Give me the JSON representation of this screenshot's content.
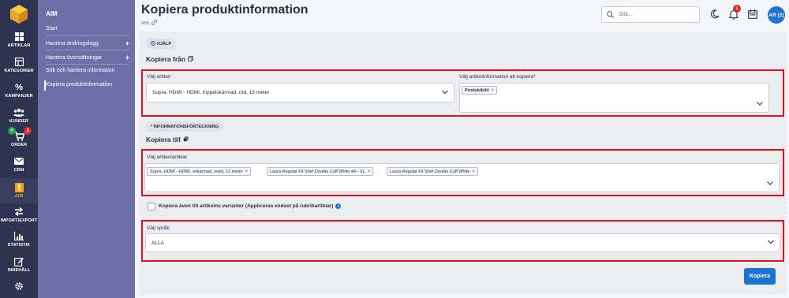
{
  "rail": {
    "items": [
      {
        "label": "ARTIKLAR",
        "icon": "grid-icon"
      },
      {
        "label": "KATEGORIER",
        "icon": "category-icon"
      },
      {
        "label": "KAMPANJER",
        "icon": "percent-icon"
      },
      {
        "label": "KUNDER",
        "icon": "users-icon"
      },
      {
        "label": "ORDER",
        "icon": "cart-icon"
      },
      {
        "label": "CRM",
        "icon": "mail-icon"
      },
      {
        "label": "AIM",
        "icon": "info-icon"
      },
      {
        "label": "IMPORT/EXPORT",
        "icon": "swap-icon"
      },
      {
        "label": "STATISTIK",
        "icon": "chart-icon"
      },
      {
        "label": "INNEHÅLL",
        "icon": "edit-icon"
      }
    ],
    "order_badges": {
      "left": "0",
      "right": "3"
    },
    "colors": {
      "green_badge": "#1fa34a",
      "red_badge": "#d92b2b"
    }
  },
  "subnav": {
    "title": "AIM",
    "items": [
      {
        "label": "Start"
      },
      {
        "label": "Hantera ändringslogg",
        "expandable": "+"
      },
      {
        "label": "Hantera översättningar",
        "expandable": "+"
      },
      {
        "label": "Sök och hantera information"
      },
      {
        "label": "Kopiera produktinformation"
      }
    ]
  },
  "header": {
    "title": "Kopiera produktinformation",
    "breadcrumb": "AIM",
    "search_placeholder": "Sök...",
    "notification_count": "1",
    "avatar": "AR (2)"
  },
  "help_pill": "HJÄLP",
  "copy_from": {
    "title": "Kopiera från",
    "article_label": "Välj artikel",
    "article_value": "Supra, HDMI - HDMI, trippelskärmad, röd, 15 meter",
    "info_label": "Välj artikelinformation att kopiera*",
    "info_tags": [
      "Produktbild"
    ]
  },
  "info_list_pill": "* INFORMATIONSFÖRTECKNING",
  "copy_to": {
    "title": "Kopiera till",
    "articles_label": "Välj artikel/artiklar",
    "article_tags": [
      "Supra, HDMI - HDMI, oskärmad, svart, 12 meter",
      "Laura Regular Fit Shirt Double Cuff White 44 - XL",
      "Laura Regular Fit Shirt Double Cuff White"
    ]
  },
  "variants_checkbox_label": "Kopiera även till artikelns varianter (Appliceras endast på rubrikartiklar)",
  "language": {
    "label": "Välj språk:",
    "value": "ALLA"
  },
  "submit_label": "Kopiera",
  "colors": {
    "accent": "#1c73d1",
    "highlight": "#e0131b",
    "sidebar": "#2e3350",
    "subnav": "#6d6fa6"
  }
}
